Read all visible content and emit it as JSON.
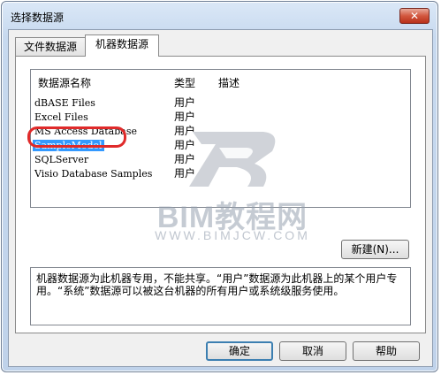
{
  "window": {
    "title": "选择数据源",
    "close_label": "✕"
  },
  "tabs": [
    {
      "label": "文件数据源"
    },
    {
      "label": "机器数据源"
    }
  ],
  "list": {
    "headers": [
      "数据源名称",
      "类型",
      "描述"
    ],
    "rows": [
      {
        "name": "dBASE Files",
        "type": "用户"
      },
      {
        "name": "Excel Files",
        "type": "用户"
      },
      {
        "name": "MS Access Database",
        "type": "用户"
      },
      {
        "name": "SampleModel",
        "type": "用户"
      },
      {
        "name": "SQLServer",
        "type": "用户"
      },
      {
        "name": "Visio Database Samples",
        "type": "用户"
      }
    ],
    "selected_index": 3
  },
  "new_button": "新建(N)...",
  "description": "机器数据源为此机器专用，不能共享。“用户”数据源为此机器上的某个用户专用。“系统”数据源可以被这台机器的所有用户或系统级服务使用。",
  "buttons": {
    "ok": "确定",
    "cancel": "取消",
    "help": "帮助"
  },
  "watermark": {
    "brand": "BIM教程网",
    "url": "WWW.BIMJCW.COM"
  },
  "colors": {
    "selection": "#3399ff",
    "highlight_ring": "#e02a2a",
    "close_button": "#c9462c"
  }
}
